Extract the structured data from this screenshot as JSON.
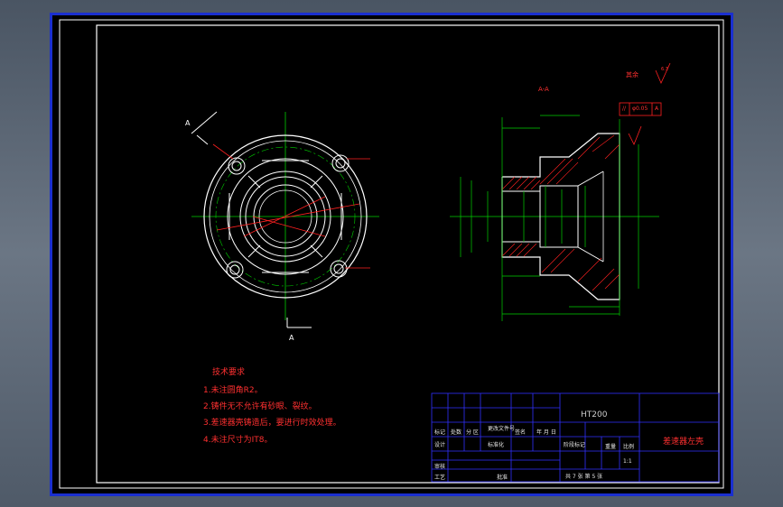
{
  "drawing": {
    "section_label_top": "A",
    "section_label_bottom": "A",
    "view_label": "A-A",
    "surface_finish_other": "其余",
    "roughness_symbol": "6.3",
    "tolerance_frame": [
      "//",
      "φ0.05",
      "A"
    ],
    "datum_label": "A"
  },
  "tech_requirements": {
    "title": "技术要求",
    "items": [
      "1.未注圆角R2。",
      "2.铸件无不允许有砂眼、裂纹。",
      "3.差速器壳铸造后，要进行时效处理。",
      "4.未注尺寸为IT8。"
    ]
  },
  "title_block": {
    "material": "HT200",
    "part_name": "差速器左壳",
    "scale": "1:1",
    "sheet_info": "共 7 张 第 5 张",
    "labels": [
      "标记",
      "处数",
      "分 区",
      "更改文件号",
      "签名",
      "年 月 日",
      "设计",
      "标准化",
      "审核",
      "工艺",
      "批准",
      "阶段标记",
      "重量",
      "比例"
    ]
  },
  "colors": {
    "frame_border": "#1a2fcf",
    "geometry": "#ffffff",
    "centerline": "#00d000",
    "dimension": "#ff2020",
    "hatch": "#ff2020",
    "title_block_lines": "#3030ff"
  }
}
